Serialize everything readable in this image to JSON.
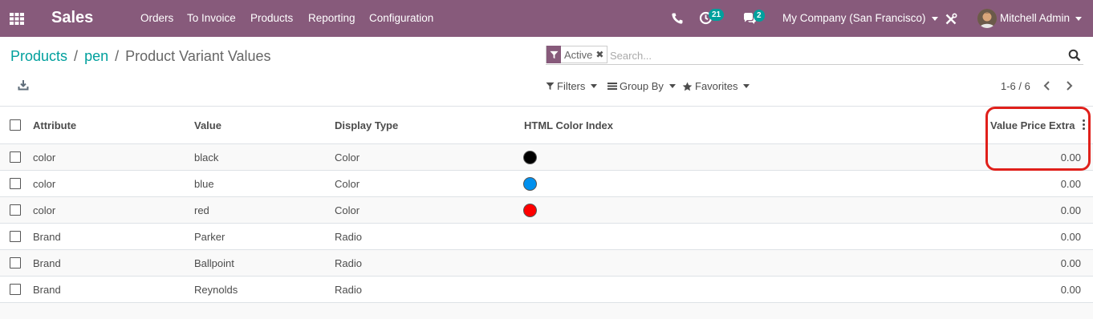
{
  "navbar": {
    "app_name": "Sales",
    "menu": [
      {
        "label": "Orders"
      },
      {
        "label": "To Invoice"
      },
      {
        "label": "Products"
      },
      {
        "label": "Reporting"
      },
      {
        "label": "Configuration"
      }
    ],
    "activity_count": "21",
    "messages_count": "2",
    "company": "My Company (San Francisco)",
    "user": "Mitchell Admin",
    "color": "#875a7b"
  },
  "breadcrumb": {
    "items": [
      "Products",
      "pen"
    ],
    "separator": "/",
    "current": "Product Variant Values"
  },
  "search": {
    "facet_label": "Active",
    "placeholder": "Search..."
  },
  "control": {
    "filters_label": "Filters",
    "groupby_label": "Group By",
    "favorites_label": "Favorites",
    "pager": "1-6 / 6"
  },
  "table": {
    "columns": [
      "Attribute",
      "Value",
      "Display Type",
      "HTML Color Index",
      "Value Price Extra"
    ],
    "rows": [
      {
        "attribute": "color",
        "value": "black",
        "display_type": "Color",
        "color": "#000000",
        "price_extra": "0.00"
      },
      {
        "attribute": "color",
        "value": "blue",
        "display_type": "Color",
        "color": "#0090ee",
        "price_extra": "0.00"
      },
      {
        "attribute": "color",
        "value": "red",
        "display_type": "Color",
        "color": "#ff0000",
        "price_extra": "0.00"
      },
      {
        "attribute": "Brand",
        "value": "Parker",
        "display_type": "Radio",
        "color": "",
        "price_extra": "0.00"
      },
      {
        "attribute": "Brand",
        "value": "Ballpoint",
        "display_type": "Radio",
        "color": "",
        "price_extra": "0.00"
      },
      {
        "attribute": "Brand",
        "value": "Reynolds",
        "display_type": "Radio",
        "color": "",
        "price_extra": "0.00"
      }
    ]
  },
  "accent": "#00a09d",
  "highlight_color": "#e0201b"
}
